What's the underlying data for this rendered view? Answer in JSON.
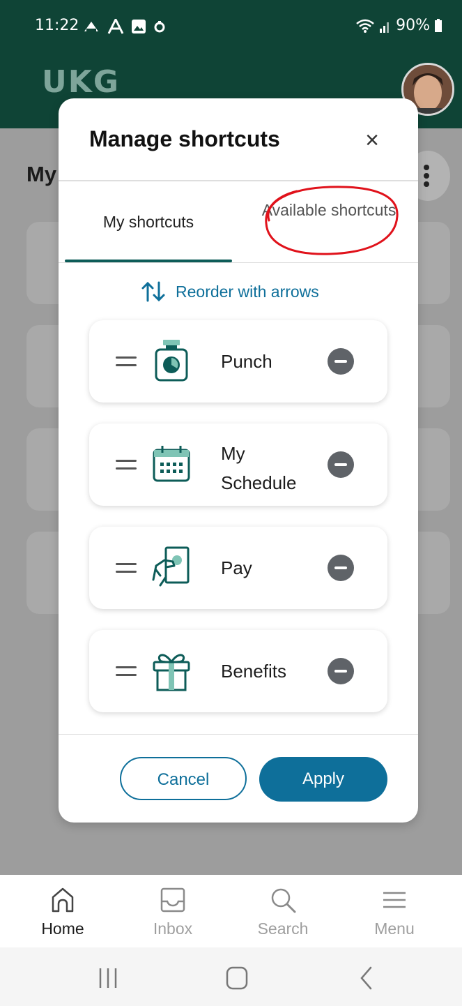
{
  "status_bar": {
    "time": "11:22",
    "battery": "90%"
  },
  "app": {
    "logo": "UKG"
  },
  "background": {
    "title": "My"
  },
  "modal": {
    "title": "Manage shortcuts",
    "close_icon": "×",
    "tabs": {
      "mine": "My shortcuts",
      "available": "Available shortcuts"
    },
    "reorder_label": "Reorder with arrows",
    "items": [
      {
        "label": "Punch",
        "icon": "punch-clock-icon"
      },
      {
        "label": "My Schedule",
        "icon": "calendar-icon"
      },
      {
        "label": "Pay",
        "icon": "pay-hand-icon"
      },
      {
        "label": "Benefits",
        "icon": "gift-icon"
      }
    ],
    "cancel_label": "Cancel",
    "apply_label": "Apply"
  },
  "bottom_nav": [
    {
      "label": "Home",
      "icon": "home-icon",
      "active": true
    },
    {
      "label": "Inbox",
      "icon": "inbox-icon",
      "active": false
    },
    {
      "label": "Search",
      "icon": "search-icon",
      "active": false
    },
    {
      "label": "Menu",
      "icon": "menu-icon",
      "active": false
    }
  ],
  "colors": {
    "header": "#0f4436",
    "accent": "#0e6f9a",
    "teal_icon": "#0d5c58",
    "annotation": "#e0121b"
  }
}
